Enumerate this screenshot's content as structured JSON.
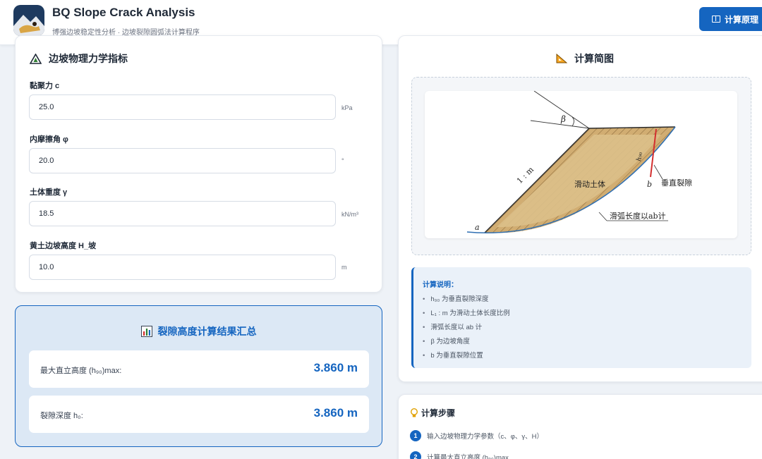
{
  "header": {
    "title": "BQ Slope Crack Analysis",
    "subtitle": "博强边坡稳定性分析 · 边坡裂隙圆弧法计算程序",
    "principle_button": "计算原理"
  },
  "params": {
    "title": "边坡物理力学指标",
    "fields": [
      {
        "label": "黏聚力 c",
        "value": "25.0",
        "unit": "kPa"
      },
      {
        "label": "内摩擦角 φ",
        "value": "20.0",
        "unit": "°"
      },
      {
        "label": "土体重度 γ",
        "value": "18.5",
        "unit": "kN/m³"
      },
      {
        "label": "黄土边坡高度 H_坡",
        "value": "10.0",
        "unit": "m"
      }
    ]
  },
  "results": {
    "title": "裂隙高度计算结果汇总",
    "rows": [
      {
        "label": "最大直立高度 (h₉₀)max:",
        "value": "3.860 m"
      },
      {
        "label": "裂隙深度 h₀:",
        "value": "3.860 m"
      }
    ]
  },
  "diagram": {
    "title": "计算简图",
    "labels": {
      "beta": "β",
      "ratio": "1 : m",
      "sliding_body": "滑动土体",
      "h90": "h₉₀",
      "b": "b",
      "crack": "垂直裂隙",
      "a": "a",
      "arc": "滑弧长度以ab计"
    }
  },
  "notes": {
    "title": "计算说明：",
    "items": [
      "h₉₀ 为垂直裂隙深度",
      "L₁ : m 为滑动土体长度比例",
      "滑弧长度以 ab 计",
      "β 为边坡角度",
      "b 为垂直裂隙位置"
    ]
  },
  "steps": {
    "title": "计算步骤",
    "items": [
      {
        "num": "1",
        "text": "输入边坡物理力学参数（c、φ、γ、H）"
      },
      {
        "num": "2",
        "text": "计算最大直立高度 (h₉₀)max"
      }
    ]
  },
  "colors": {
    "accent": "#1565c0",
    "soil": "#c9a468",
    "crack": "#d32f2f"
  }
}
